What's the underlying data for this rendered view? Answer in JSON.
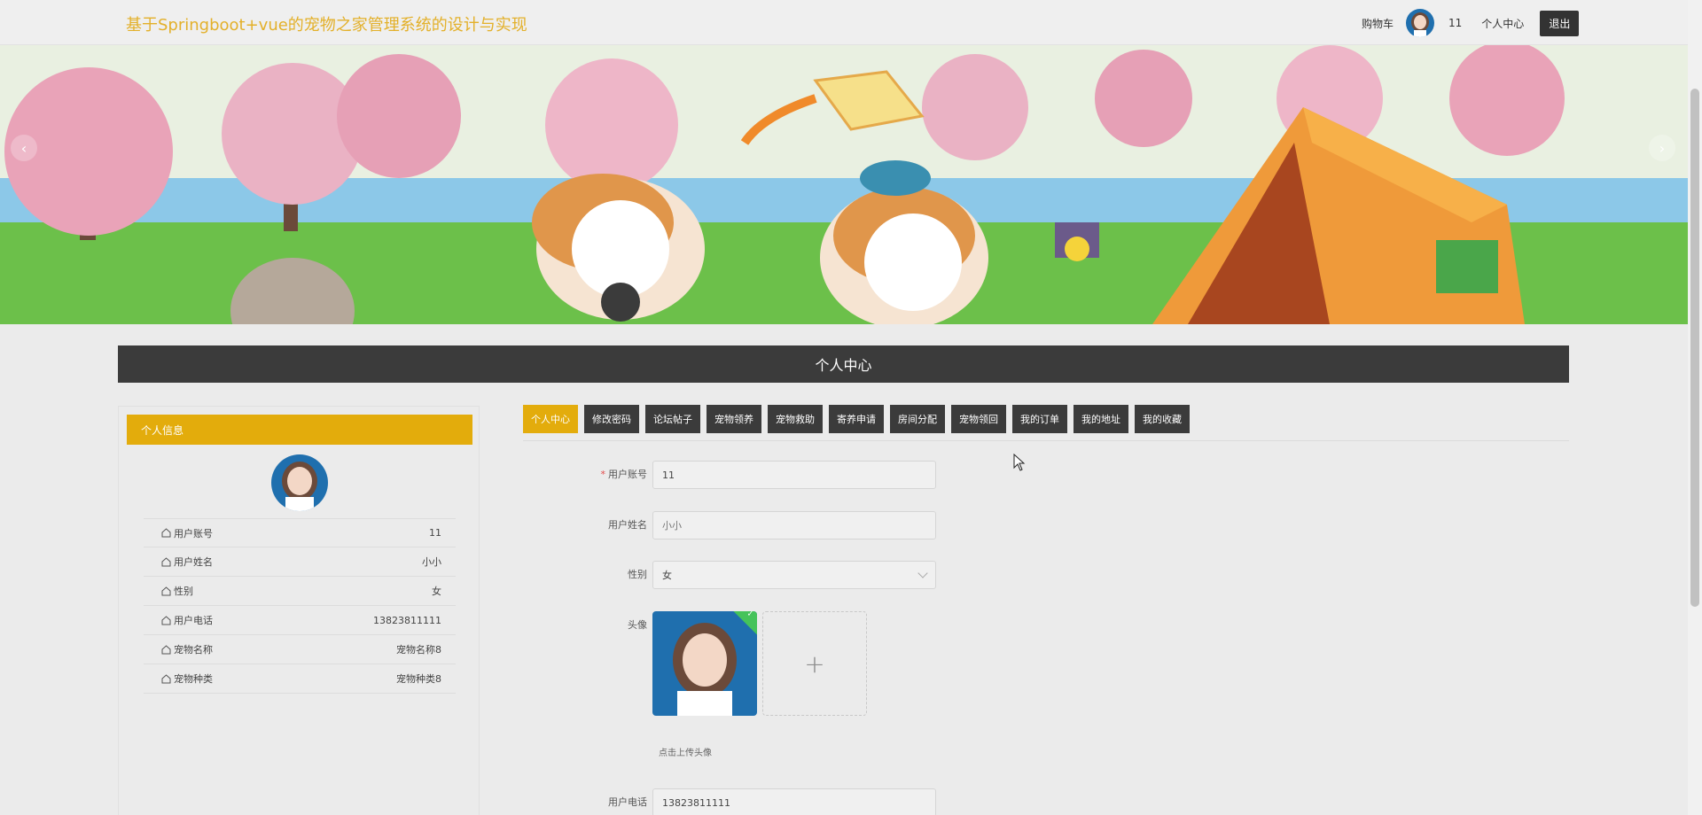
{
  "header": {
    "site_title": "基于Springboot+vue的宠物之家管理系统的设计与实现",
    "cart_label": "购物车",
    "username": "11",
    "user_center_label": "个人中心",
    "logout_label": "退出"
  },
  "banner": {
    "prev_label": "‹",
    "next_label": "›"
  },
  "section": {
    "title": "个人中心"
  },
  "profile": {
    "header": "个人信息",
    "rows": [
      {
        "label": "用户账号",
        "value": "11"
      },
      {
        "label": "用户姓名",
        "value": "小小"
      },
      {
        "label": "性别",
        "value": "女"
      },
      {
        "label": "用户电话",
        "value": "13823811111"
      },
      {
        "label": "宠物名称",
        "value": "宠物名称8"
      },
      {
        "label": "宠物种类",
        "value": "宠物种类8"
      }
    ]
  },
  "tabs": [
    {
      "label": "个人中心",
      "active": true
    },
    {
      "label": "修改密码"
    },
    {
      "label": "论坛帖子"
    },
    {
      "label": "宠物领养"
    },
    {
      "label": "宠物救助"
    },
    {
      "label": "寄养申请"
    },
    {
      "label": "房间分配"
    },
    {
      "label": "宠物领回"
    },
    {
      "label": "我的订单"
    },
    {
      "label": "我的地址"
    },
    {
      "label": "我的收藏"
    }
  ],
  "form": {
    "account_label": "用户账号",
    "account_value": "11",
    "name_label": "用户姓名",
    "name_value": "小小",
    "gender_label": "性别",
    "gender_value": "女",
    "avatar_label": "头像",
    "upload_plus": "+",
    "upload_tip": "点击上传头像",
    "phone_label": "用户电话",
    "phone_value": "13823811111"
  },
  "colors": {
    "accent": "#e3ac0c",
    "title": "#e3b02a",
    "dark": "#3b3b3b"
  }
}
